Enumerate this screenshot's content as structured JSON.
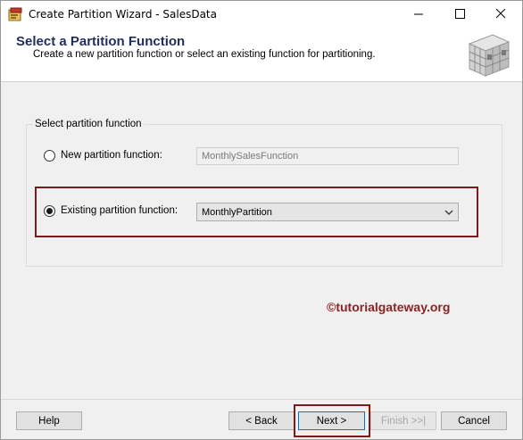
{
  "window": {
    "title": "Create Partition Wizard - SalesData",
    "icon": "wizard-app-icon",
    "controls": {
      "minimize_icon": "minimize-icon",
      "maximize_icon": "maximize-icon",
      "close_icon": "close-icon"
    }
  },
  "header": {
    "title": "Select a Partition Function",
    "description": "Create a new partition function or select an existing function for partitioning.",
    "logo_icon": "partition-cube-icon"
  },
  "group": {
    "label": "Select partition function",
    "new_option": {
      "label": "New partition function:",
      "selected": false,
      "value": "MonthlySalesFunction",
      "enabled": false
    },
    "existing_option": {
      "label": "Existing partition function:",
      "selected": true,
      "value": "MonthlyPartition"
    }
  },
  "watermark": "©tutorialgateway.org",
  "buttons": {
    "help": "Help",
    "back": "< Back",
    "next": "Next >",
    "finish": "Finish >>|",
    "cancel": "Cancel"
  },
  "colors": {
    "highlight_border": "#7b1c1c",
    "header_title": "#1f2f5a",
    "watermark": "#8b2323"
  }
}
